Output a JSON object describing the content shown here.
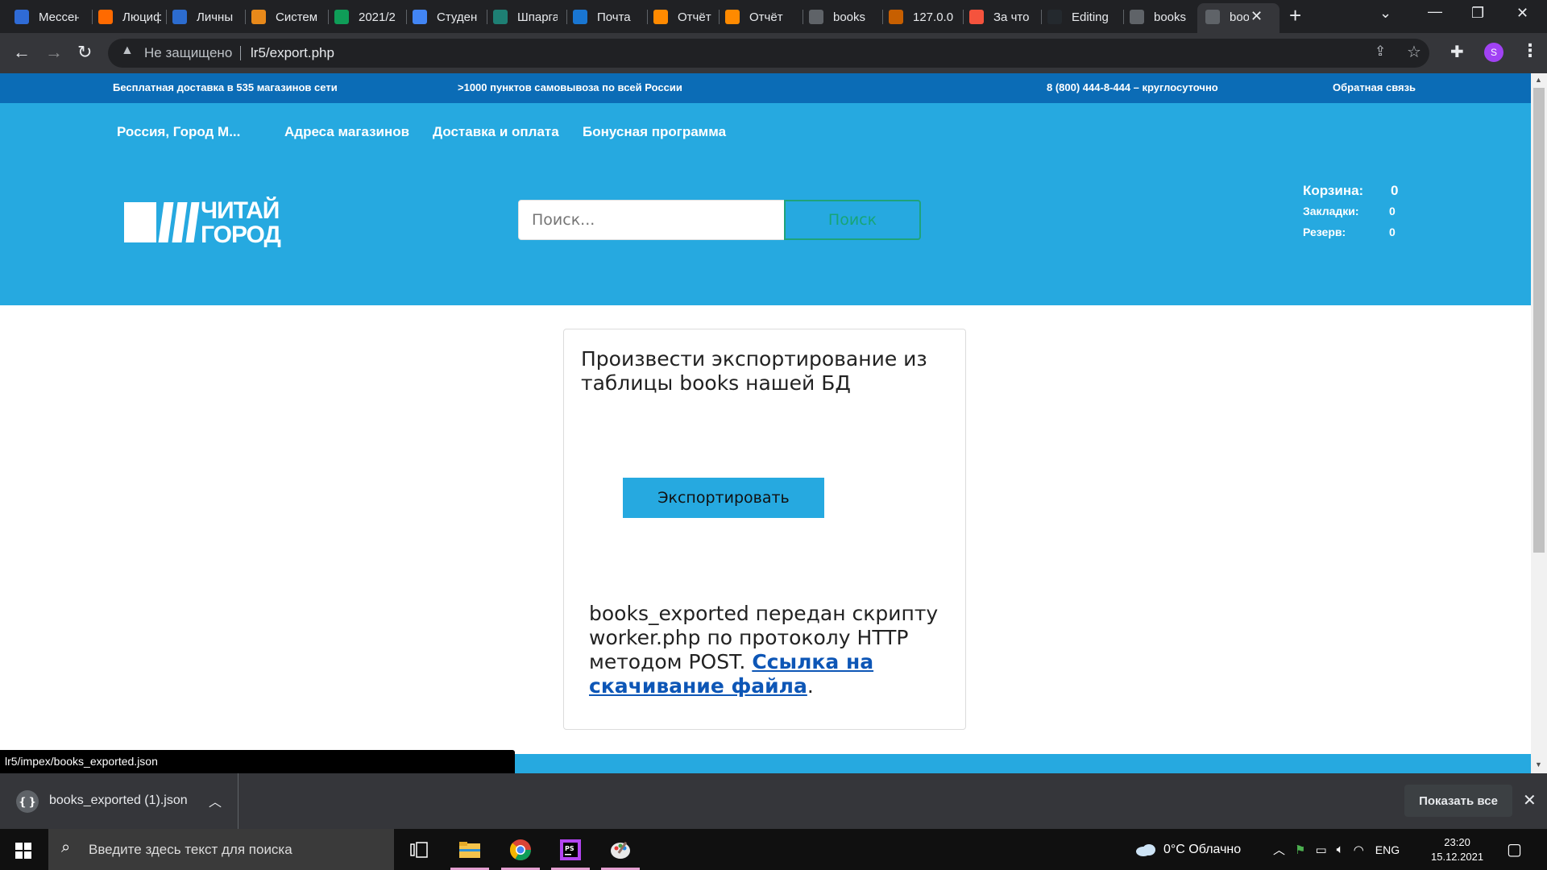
{
  "browser": {
    "tabs": [
      {
        "label": "Мессен",
        "icon": "messenger-icon",
        "color": "#2f6bd6"
      },
      {
        "label": "Люциф",
        "icon": "litres-icon",
        "color": "#ff6a00"
      },
      {
        "label": "Личны",
        "icon": "personal-icon",
        "color": "#2c6ccf"
      },
      {
        "label": "Систем",
        "icon": "moodle-icon",
        "color": "#e8891a"
      },
      {
        "label": "2021/2",
        "icon": "sheets-icon",
        "color": "#0f9d58"
      },
      {
        "label": "Студен",
        "icon": "docs-icon",
        "color": "#4285f4"
      },
      {
        "label": "Шпарга",
        "icon": "cheatsheet-icon",
        "color": "#1e7f74"
      },
      {
        "label": "Почта",
        "icon": "mail-icon",
        "color": "#1976d2"
      },
      {
        "label": "Отчёт",
        "icon": "cloud-orange-icon",
        "color": "#ff8a00"
      },
      {
        "label": "Отчёт",
        "icon": "cloud-orange-icon",
        "color": "#ff8a00"
      },
      {
        "label": "books",
        "icon": "globe-icon",
        "color": "#5f6368"
      },
      {
        "label": "127.0.0",
        "icon": "xampp-icon",
        "color": "#c75f00"
      },
      {
        "label": "За что",
        "icon": "habr-icon",
        "color": "#f5533d"
      },
      {
        "label": "Editing",
        "icon": "github-icon",
        "color": "#24292e"
      },
      {
        "label": "books",
        "icon": "globe-icon",
        "color": "#5f6368"
      },
      {
        "label": "boo",
        "icon": "globe-icon",
        "color": "#5f6368"
      }
    ],
    "omnibox": {
      "security": "Не защищено",
      "url": "lr5/export.php"
    },
    "profile_initial": "S",
    "status_url": "lr5/impex/books_exported.json"
  },
  "site": {
    "topbar": {
      "delivery": "Бесплатная доставка в 535 магазинов сети",
      "pickup": ">1000 пунктов самовывоза по всей России",
      "phone": "8 (800) 444-8-444 – круглосуточно",
      "feedback": "Обратная связь"
    },
    "nav": {
      "city": "Россия, Город М...",
      "stores": "Адреса магазинов",
      "delivery": "Доставка и оплата",
      "bonus": "Бонусная программа"
    },
    "logo": {
      "line1": "ЧИТАЙ",
      "line2": "ГОРОД"
    },
    "search": {
      "placeholder": "Поиск...",
      "button": "Поиск"
    },
    "counters": [
      {
        "label": "Корзина:",
        "value": "0"
      },
      {
        "label": "Закладки:",
        "value": "0"
      },
      {
        "label": "Резерв:",
        "value": "0"
      }
    ]
  },
  "card": {
    "title": "Произвести экспортирование из таблицы books нашей БД",
    "export_button": "Экспортировать",
    "result_text": "books_exported передан скрипту worker.php по протоколу HTTP методом POST. ",
    "result_link": "Ссылка на скачивание файла",
    "result_end": "."
  },
  "downloads": {
    "file_name": "books_exported (1).json",
    "show_all": "Показать все"
  },
  "taskbar": {
    "search_placeholder": "Введите здесь текст для поиска",
    "weather": "0°C  Облачно",
    "language": "ENG",
    "time": "23:20",
    "date": "15.12.2021"
  }
}
